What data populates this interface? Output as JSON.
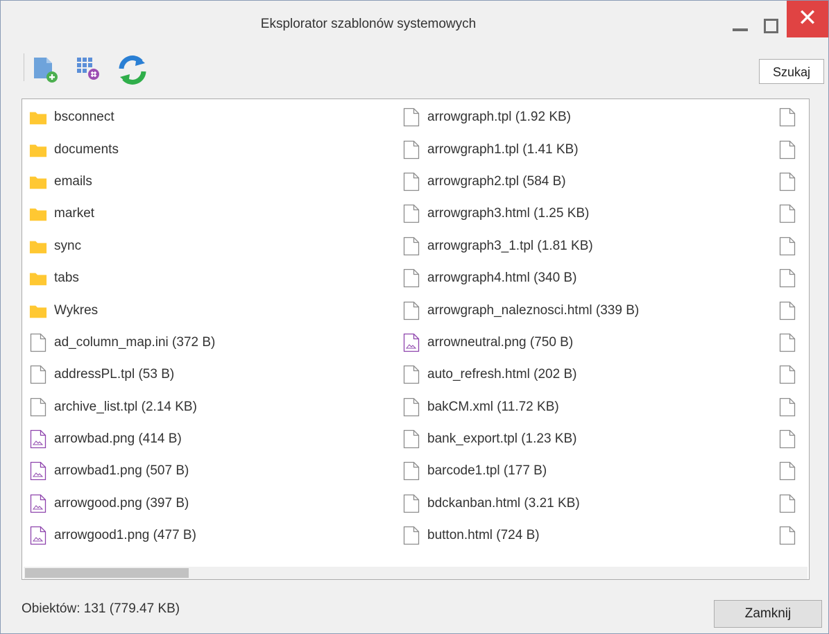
{
  "window": {
    "title": "Eksplorator szablonów systemowych",
    "close_glyph": "✕"
  },
  "toolbar": {
    "search_label": "Szukaj",
    "icons": [
      "new-file-icon",
      "grid-view-icon",
      "refresh-icon"
    ]
  },
  "columns": [
    [
      {
        "type": "folder",
        "label": "bsconnect"
      },
      {
        "type": "folder",
        "label": "documents"
      },
      {
        "type": "folder",
        "label": "emails"
      },
      {
        "type": "folder",
        "label": "market"
      },
      {
        "type": "folder",
        "label": "sync"
      },
      {
        "type": "folder",
        "label": "tabs"
      },
      {
        "type": "folder",
        "label": "Wykres"
      },
      {
        "type": "file",
        "label": "ad_column_map.ini (372 B)"
      },
      {
        "type": "file",
        "label": "addressPL.tpl (53 B)"
      },
      {
        "type": "file",
        "label": "archive_list.tpl (2.14 KB)"
      },
      {
        "type": "image",
        "label": "arrowbad.png (414 B)"
      },
      {
        "type": "image",
        "label": "arrowbad1.png (507 B)"
      },
      {
        "type": "image",
        "label": "arrowgood.png (397 B)"
      },
      {
        "type": "image",
        "label": "arrowgood1.png (477 B)"
      }
    ],
    [
      {
        "type": "file",
        "label": "arrowgraph.tpl (1.92 KB)"
      },
      {
        "type": "file",
        "label": "arrowgraph1.tpl (1.41 KB)"
      },
      {
        "type": "file",
        "label": "arrowgraph2.tpl (584 B)"
      },
      {
        "type": "file",
        "label": "arrowgraph3.html (1.25 KB)"
      },
      {
        "type": "file",
        "label": "arrowgraph3_1.tpl (1.81 KB)"
      },
      {
        "type": "file",
        "label": "arrowgraph4.html (340 B)"
      },
      {
        "type": "file",
        "label": "arrowgraph_naleznosci.html (339 B)"
      },
      {
        "type": "image",
        "label": "arrowneutral.png (750 B)"
      },
      {
        "type": "file",
        "label": "auto_refresh.html (202 B)"
      },
      {
        "type": "file",
        "label": "bakCM.xml (11.72 KB)"
      },
      {
        "type": "file",
        "label": "bank_export.tpl (1.23 KB)"
      },
      {
        "type": "file",
        "label": "barcode1.tpl (177 B)"
      },
      {
        "type": "file",
        "label": "bdckanban.html (3.21 KB)"
      },
      {
        "type": "file",
        "label": "button.html (724 B)"
      }
    ],
    [
      {
        "type": "file",
        "label": ""
      },
      {
        "type": "file",
        "label": ""
      },
      {
        "type": "file",
        "label": ""
      },
      {
        "type": "file",
        "label": ""
      },
      {
        "type": "file",
        "label": ""
      },
      {
        "type": "file",
        "label": ""
      },
      {
        "type": "file",
        "label": ""
      },
      {
        "type": "file",
        "label": ""
      },
      {
        "type": "file",
        "label": ""
      },
      {
        "type": "file",
        "label": ""
      },
      {
        "type": "file",
        "label": ""
      },
      {
        "type": "file",
        "label": ""
      },
      {
        "type": "file",
        "label": ""
      },
      {
        "type": "file",
        "label": ""
      }
    ]
  ],
  "status": {
    "text": "Obiektów: 131 (779.47 KB)"
  },
  "footer": {
    "close_label": "Zamknij"
  },
  "colors": {
    "folder": "#ffc832",
    "file_outline": "#8c8c8c",
    "image_outline": "#8e44ad",
    "close_red": "#e04343"
  }
}
